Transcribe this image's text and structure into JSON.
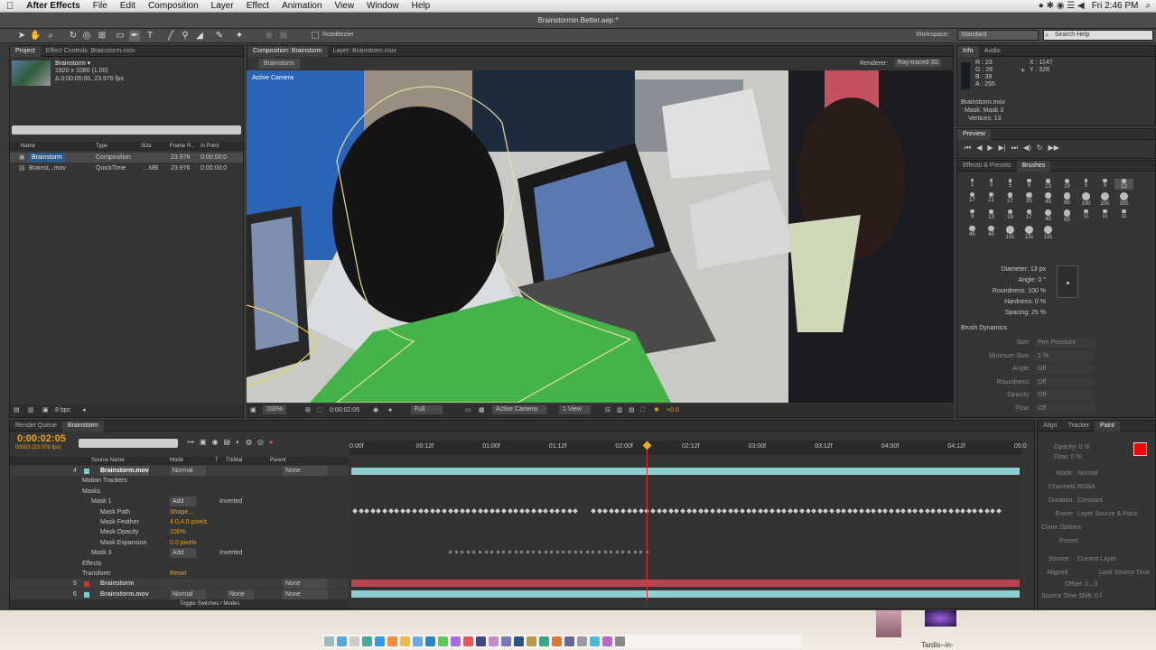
{
  "menubar": {
    "apple": "",
    "app_name": "After Effects",
    "items": [
      "File",
      "Edit",
      "Composition",
      "Layer",
      "Effect",
      "Animation",
      "View",
      "Window",
      "Help"
    ],
    "clock": "Fri 2:46 PM"
  },
  "window_title": "Brainstormin Better.aep *",
  "toolbar": {
    "rotobezier_label": "RotoBezier",
    "workspace_label": "Workspace:",
    "workspace_value": "Standard",
    "search_placeholder": "Search Help"
  },
  "project": {
    "tabs": [
      "Project",
      "Effect Controls: Brainstorm.mov"
    ],
    "thumb_name": "Brainstorm ▾",
    "thumb_info1": "1920 x 1080 (1.00)",
    "thumb_info2": "Δ 0:00:05:00, 23.976 fps",
    "columns": [
      "Name",
      "Type",
      "Size",
      "Frame R...",
      "In Point"
    ],
    "items": [
      {
        "name": "Brainstorm",
        "type": "Composition",
        "size": "",
        "fps": "23.976",
        "in": "0:00:00:0"
      },
      {
        "name": "Brainst...mov",
        "type": "QuickTime",
        "size": "...MB",
        "fps": "23.976",
        "in": "0:00:00:0"
      }
    ],
    "bpc": "8 bpc"
  },
  "comp": {
    "tabs": [
      "Composition: Brainstorm",
      "Layer: Brainstorm.mov"
    ],
    "sub_tab": "Brainstorm",
    "renderer_label": "Renderer:",
    "renderer_value": "Ray-traced 3D",
    "camera_label": "Active Camera",
    "footer": {
      "zoom": "100%",
      "time": "0:00:02:05",
      "res": "Full",
      "camera": "Active Camera",
      "views": "1 View",
      "offset": "+0.0"
    }
  },
  "info": {
    "tabs": [
      "Info",
      "Audio"
    ],
    "r": "R : 23",
    "g": "G : 28",
    "b": "B : 39",
    "a": "A : 255",
    "x": "X : 1147",
    "y": "Y : 328",
    "layer": "Brainstorm.mov",
    "mask": "Mask: Mask 3",
    "vertices": "Vertices: 13"
  },
  "preview": {
    "tab": "Preview"
  },
  "brushes": {
    "tabs": [
      "Effects & Presets",
      "Brushes"
    ],
    "sizes": [
      "1",
      "3",
      "5",
      "9",
      "13",
      "19",
      "5",
      "9",
      "13",
      "17",
      "21",
      "27",
      "35",
      "45",
      "65",
      "100",
      "200",
      "300",
      "9",
      "13",
      "19",
      "17",
      "45",
      "65",
      "11",
      "11",
      "11",
      "45",
      "45",
      "131",
      "131",
      "131"
    ],
    "diameter": "Diameter: 13 px",
    "angle": "Angle: 0 °",
    "roundness": "Roundness: 100 %",
    "hardness": "Hardness: 0 %",
    "spacing": "Spacing: 25 %",
    "dynamics_title": "Brush Dynamics",
    "dyn": [
      {
        "label": "Size:",
        "value": "Pen Pressure"
      },
      {
        "label": "Minimum Size:",
        "value": "1 %"
      },
      {
        "label": "Angle:",
        "value": "Off"
      },
      {
        "label": "Roundness:",
        "value": "Off"
      },
      {
        "label": "Opacity:",
        "value": "Off"
      },
      {
        "label": "Flow:",
        "value": "Off"
      }
    ]
  },
  "timeline": {
    "tabs": [
      "Render Queue",
      "Brainstorm"
    ],
    "timecode": "0:00:02:05",
    "fps_note": "00053 (23.976 fps)",
    "columns": [
      "Source Name",
      "Mode",
      "T",
      "TrkMat",
      "Parent"
    ],
    "ruler": [
      "0:00f",
      "00:12f",
      "01:00f",
      "01:12f",
      "02:00f",
      "02:12f",
      "03:00f",
      "03:12f",
      "04:00f",
      "04:12f",
      "05:0"
    ],
    "rows": [
      {
        "num": "4",
        "name": "Brainstorm.mov",
        "mode": "Normal",
        "parent": "None"
      },
      {
        "name": "Motion Trackers"
      },
      {
        "name": "Masks"
      },
      {
        "name": "Mask 1",
        "mode": "Add",
        "extra": "Inverted"
      },
      {
        "name": "Mask Path",
        "value": "Shape..."
      },
      {
        "name": "Mask Feather",
        "value": "4.0,4.0 pixels"
      },
      {
        "name": "Mask Opacity",
        "value": "100%"
      },
      {
        "name": "Mask Expansion",
        "value": "0.0 pixels"
      },
      {
        "name": "Mask 3",
        "mode": "Add",
        "extra": "Inverted"
      },
      {
        "name": "Effects"
      },
      {
        "name": "Transform",
        "value": "Reset"
      },
      {
        "num": "5",
        "name": "Brainstorm",
        "parent": "None"
      },
      {
        "num": "6",
        "name": "Brainstorm.mov",
        "mode": "Normal",
        "trkmat": "None",
        "parent": "None"
      }
    ],
    "toggle": "Toggle Switches / Modes"
  },
  "paint": {
    "tabs": [
      "Align",
      "Tracker",
      "Paint"
    ],
    "opacity": "Opacity: 0 %",
    "flow": "Flow: 0 %",
    "mode_label": "Mode:",
    "mode_value": "Normal",
    "channels_label": "Channels:",
    "channels_value": "RGBA",
    "duration_label": "Duration:",
    "duration_value": "Constant",
    "erase_label": "Erase:",
    "erase_value": "Layer Source & Paint",
    "clone_title": "Clone Options",
    "preset_label": "Preset:",
    "source_label": "Source:",
    "source_value": "Current Layer",
    "aligned": "Aligned",
    "lock": "Lock Source Time",
    "offset": "Offset: 0 ,  0",
    "shift": "Source Time Shift: 0 f",
    "color": "#ff0000"
  },
  "desktop": {
    "label1": "",
    "label2": "Tardis--in-"
  }
}
